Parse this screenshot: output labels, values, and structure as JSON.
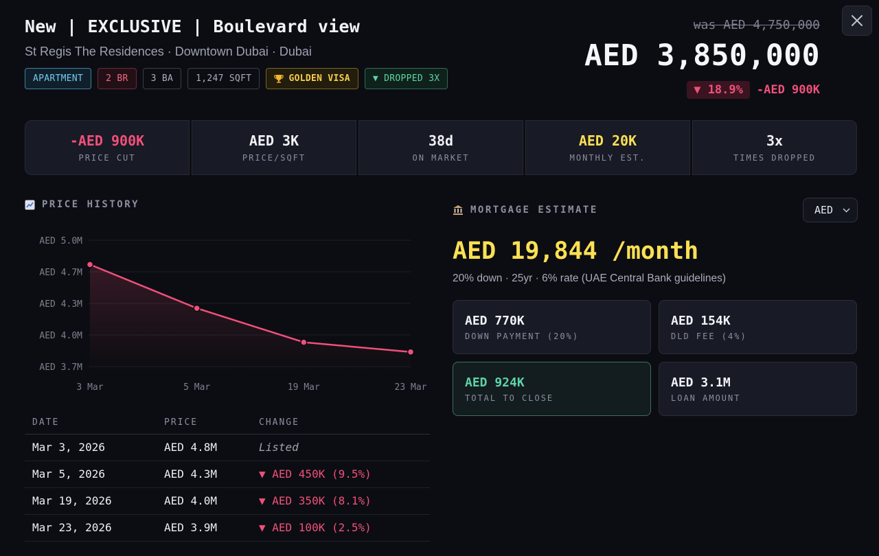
{
  "listing": {
    "title": "New | EXCLUSIVE | Boulevard view",
    "subtitle": "St Regis The Residences · Downtown Dubai · Dubai",
    "tags": [
      "APARTMENT",
      "2 BR",
      "3 BA",
      "1,247 SQFT",
      "GOLDEN VISA",
      "▼ DROPPED 3X"
    ],
    "was_price": "was AED 4,750,000",
    "price": "AED 3,850,000",
    "change_pct": "▼ 18.9%",
    "change_abs": "-AED 900K"
  },
  "stats": [
    {
      "value": "-AED 900K",
      "label": "PRICE CUT"
    },
    {
      "value": "AED 3K",
      "label": "PRICE/SQFT"
    },
    {
      "value": "38d",
      "label": "ON MARKET"
    },
    {
      "value": "AED 20K",
      "label": "MONTHLY EST."
    },
    {
      "value": "3x",
      "label": "TIMES DROPPED"
    }
  ],
  "price_history": {
    "heading": "PRICE HISTORY",
    "columns": [
      "DATE",
      "PRICE",
      "CHANGE"
    ],
    "rows": [
      {
        "date": "Mar 3, 2026",
        "price": "AED 4.8M",
        "change": "Listed"
      },
      {
        "date": "Mar 5, 2026",
        "price": "AED 4.3M",
        "change": "▼ AED 450K (9.5%)"
      },
      {
        "date": "Mar 19, 2026",
        "price": "AED 4.0M",
        "change": "▼ AED 350K (8.1%)"
      },
      {
        "date": "Mar 23, 2026",
        "price": "AED 3.9M",
        "change": "▼ AED 100K (2.5%)"
      }
    ]
  },
  "chart_data": {
    "type": "line",
    "categories": [
      "3 Mar",
      "5 Mar",
      "19 Mar",
      "23 Mar"
    ],
    "values": [
      4750000,
      4300000,
      3950000,
      3850000
    ],
    "y_ticks": [
      "AED 5.0M",
      "AED 4.7M",
      "AED 4.3M",
      "AED 4.0M",
      "AED 3.7M"
    ],
    "ylim": [
      3650000,
      5000000
    ],
    "grid": true,
    "color": "#f0507a"
  },
  "mortgage": {
    "heading": "MORTGAGE ESTIMATE",
    "currency": "AED",
    "monthly": "AED 19,844 /month",
    "terms": "20% down · 25yr · 6% rate (UAE Central Bank guidelines)",
    "cards": [
      {
        "value": "AED 770K",
        "label": "DOWN PAYMENT (20%)"
      },
      {
        "value": "AED 154K",
        "label": "DLD FEE (4%)"
      },
      {
        "value": "AED 924K",
        "label": "TOTAL TO CLOSE"
      },
      {
        "value": "AED 3.1M",
        "label": "LOAN AMOUNT"
      }
    ]
  },
  "icons": {
    "close": "close-icon",
    "chart": "chart-icon",
    "bank": "bank-icon",
    "trophy": "trophy-icon",
    "chevron": "chevron-down-icon"
  },
  "colors": {
    "background": "#0c0d12",
    "accent_red": "#f0507a",
    "accent_yellow": "#fbe053",
    "accent_green": "#5fd3a6"
  }
}
